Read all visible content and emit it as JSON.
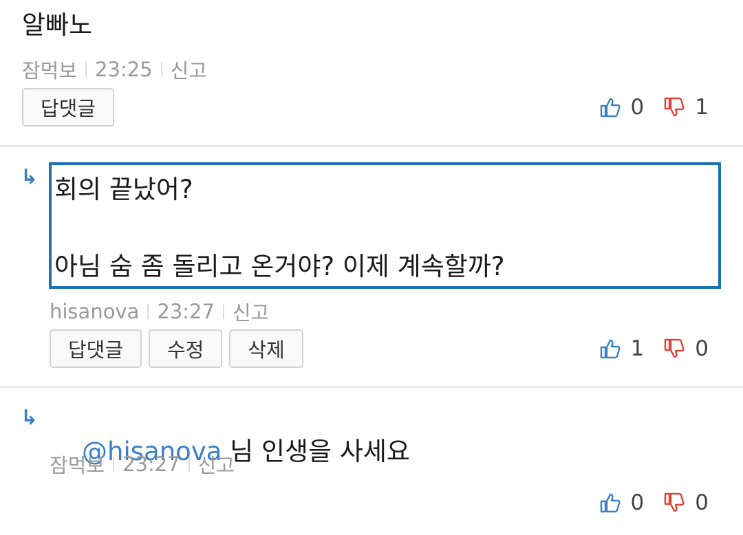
{
  "comments": [
    {
      "text": "알빠노",
      "author": "잠먹보",
      "time": "23:25",
      "report": "신고",
      "buttons": [
        "답댓글"
      ],
      "likes": "0",
      "dislikes": "1"
    },
    {
      "is_reply": true,
      "arrow": "↳",
      "text": "회의 끝났어?\n\n아님 숨 좀 돌리고 온거야? 이제 계속할까?",
      "author": "hisanova",
      "time": "23:27",
      "report": "신고",
      "buttons": [
        "답댓글",
        "수정",
        "삭제"
      ],
      "likes": "1",
      "dislikes": "0"
    },
    {
      "is_reply": true,
      "arrow": "↳",
      "mention": "@hisanova",
      "text": " 님 인생을 사세요",
      "author": "잠먹보",
      "time": "23:27",
      "report": "신고",
      "likes": "0",
      "dislikes": "0"
    }
  ],
  "icons": {
    "like": "thumbs-up-icon",
    "dislike": "thumbs-down-icon",
    "reply": "reply-arrow-icon"
  },
  "colors": {
    "like": "#3b7fc4",
    "dislike": "#e0413a",
    "mention": "#3b7fc4",
    "edit_border": "#1c6fb4"
  }
}
